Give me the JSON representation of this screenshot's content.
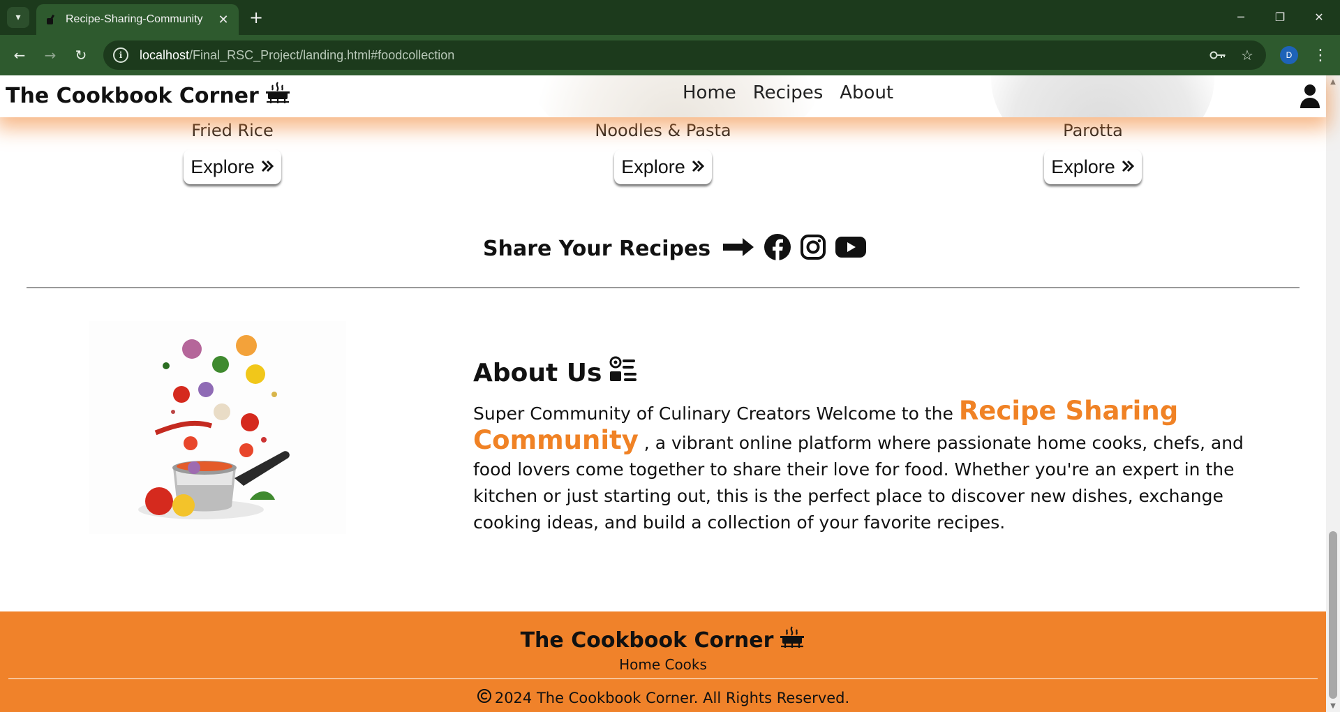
{
  "browser": {
    "tab_title": "Recipe-Sharing-Community",
    "url_host": "localhost",
    "url_path": "/Final_RSC_Project/landing.html#foodcollection",
    "profile_initial": "D"
  },
  "navbar": {
    "brand": "The Cookbook Corner",
    "links": [
      {
        "label": "Home"
      },
      {
        "label": "Recipes"
      },
      {
        "label": "About"
      }
    ]
  },
  "food_cards": [
    {
      "name": "Fried Rice",
      "button": "Explore"
    },
    {
      "name": "Noodles & Pasta",
      "button": "Explore"
    },
    {
      "name": "Parotta",
      "button": "Explore"
    }
  ],
  "share": {
    "text": "Share Your Recipes",
    "icons": [
      "arrow-right-icon",
      "facebook-icon",
      "instagram-icon",
      "youtube-icon"
    ]
  },
  "about": {
    "title": "About Us",
    "intro": "Super Community of Culinary Creators Welcome to the ",
    "highlight": "Recipe Sharing Community",
    "body": " , a vibrant online platform where passionate home cooks, chefs, and food lovers come together to share their love for food. Whether you're an expert in the kitchen or just starting out, this is the perfect place to discover new dishes, exchange cooking ideas, and build a collection of your favorite recipes."
  },
  "footer": {
    "brand": "The Cookbook Corner",
    "tagline": "Home Cooks",
    "copyright": "2024 The Cookbook Corner. All Rights Reserved."
  },
  "colors": {
    "accent": "#f0822a",
    "highlight": "#f08225",
    "browser_frame": "#1c3a1c",
    "browser_toolbar": "#2e5a2e"
  }
}
